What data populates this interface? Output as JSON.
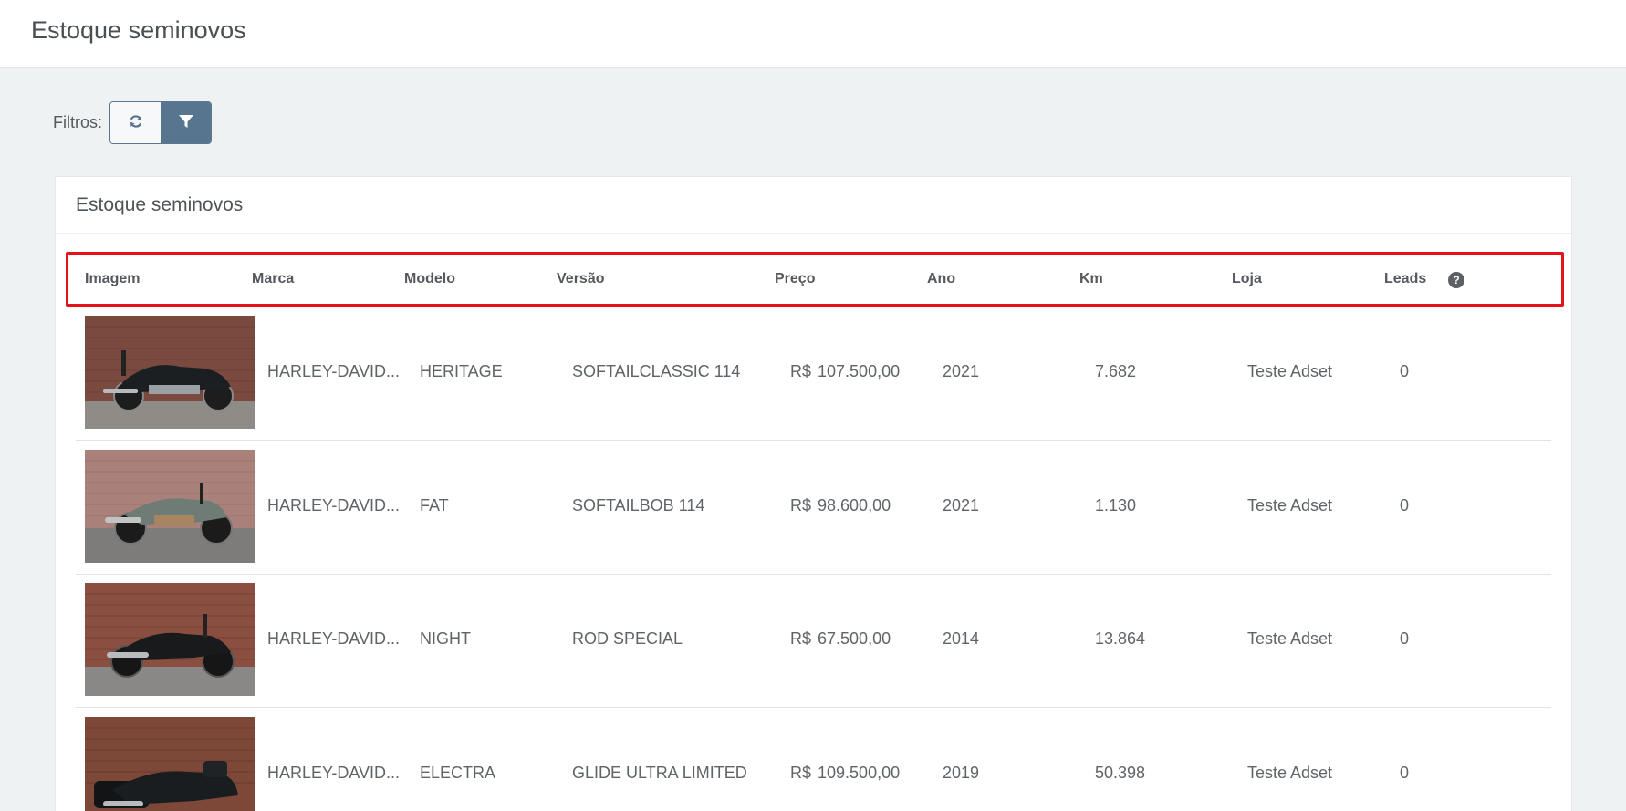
{
  "header": {
    "title": "Estoque seminovos"
  },
  "filters": {
    "label": "Filtros:",
    "refresh_icon": "refresh-icon",
    "filter_icon": "filter-icon"
  },
  "card": {
    "title": "Estoque seminovos"
  },
  "table": {
    "columns": [
      "Imagem",
      "Marca",
      "Modelo",
      "Versão",
      "Preço",
      "Ano",
      "Km",
      "Loja",
      "Leads"
    ],
    "help_icon": "?",
    "rows": [
      {
        "marca": "HARLEY-DAVID...",
        "modelo": "HERITAGE",
        "versao": "SOFTAILCLASSIC 114",
        "moeda": "R$",
        "preco": "107.500,00",
        "ano": "2021",
        "km": "7.682",
        "loja": "Teste Adset",
        "leads": "0"
      },
      {
        "marca": "HARLEY-DAVID...",
        "modelo": "FAT",
        "versao": "SOFTAILBOB 114",
        "moeda": "R$",
        "preco": "98.600,00",
        "ano": "2021",
        "km": "1.130",
        "loja": "Teste Adset",
        "leads": "0"
      },
      {
        "marca": "HARLEY-DAVID...",
        "modelo": "NIGHT",
        "versao": "ROD SPECIAL",
        "moeda": "R$",
        "preco": "67.500,00",
        "ano": "2014",
        "km": "13.864",
        "loja": "Teste Adset",
        "leads": "0"
      },
      {
        "marca": "HARLEY-DAVID...",
        "modelo": "ELECTRA",
        "versao": "GLIDE ULTRA LIMITED",
        "moeda": "R$",
        "preco": "109.500,00",
        "ano": "2019",
        "km": "50.398",
        "loja": "Teste Adset",
        "leads": "0"
      }
    ]
  },
  "colors": {
    "accent": "#587590",
    "highlight_border": "#e3121b",
    "background": "#eef2f3"
  }
}
